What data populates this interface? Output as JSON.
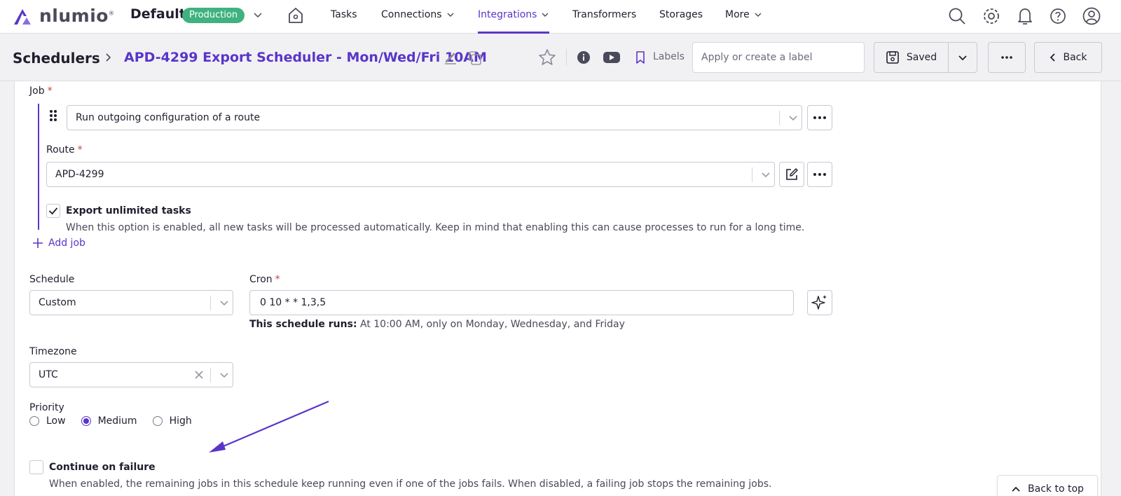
{
  "nav": {
    "logo_text": "nlumio",
    "logo_mark": "®",
    "environment": "Default",
    "environment_badge": "Production",
    "items": [
      {
        "label": "Tasks"
      },
      {
        "label": "Connections"
      },
      {
        "label": "Integrations"
      },
      {
        "label": "Transformers"
      },
      {
        "label": "Storages"
      },
      {
        "label": "More"
      }
    ],
    "active_item": "Integrations",
    "icons": [
      "home-icon",
      "search-icon",
      "gear-icon",
      "bell-icon",
      "help-icon",
      "user-icon"
    ]
  },
  "header": {
    "breadcrumb_root": "Schedulers",
    "title": "APD-4299 Export Scheduler - Mon/Wed/Fri 10AM",
    "labels_text": "Labels",
    "label_placeholder": "Apply or create a label",
    "saved_label": "Saved",
    "back_label": "Back"
  },
  "form": {
    "job": {
      "label": "Job",
      "required_mark": "*",
      "value": "Run outgoing configuration of a route"
    },
    "route": {
      "label": "Route",
      "required_mark": "*",
      "value": "APD-4299"
    },
    "export_unlimited": {
      "label": "Export unlimited tasks",
      "checked": true,
      "help": "When this option is enabled, all new tasks will be processed automatically. Keep in mind that enabling this can cause processes to run for a long time."
    },
    "add_job_label": "Add job",
    "schedule": {
      "label": "Schedule",
      "value": "Custom"
    },
    "cron": {
      "label": "Cron",
      "required_mark": "*",
      "value": "0 10 * * 1,3,5",
      "runs_label": "This schedule runs:",
      "runs_text": "At 10:00 AM, only on Monday, Wednesday, and Friday"
    },
    "timezone": {
      "label": "Timezone",
      "value": "UTC"
    },
    "priority": {
      "label": "Priority",
      "options": [
        "Low",
        "Medium",
        "High"
      ],
      "selected": "Medium"
    },
    "continue_on_failure": {
      "label": "Continue on failure",
      "checked": false,
      "help": "When enabled, the remaining jobs in this schedule keep running even if one of the jobs fails. When disabled, a failing job stops the remaining jobs."
    }
  },
  "back_to_top_label": "Back to top",
  "colors": {
    "accent": "#5a35c8",
    "badge_green": "#3fb27f",
    "required_red": "#d63b3b"
  }
}
